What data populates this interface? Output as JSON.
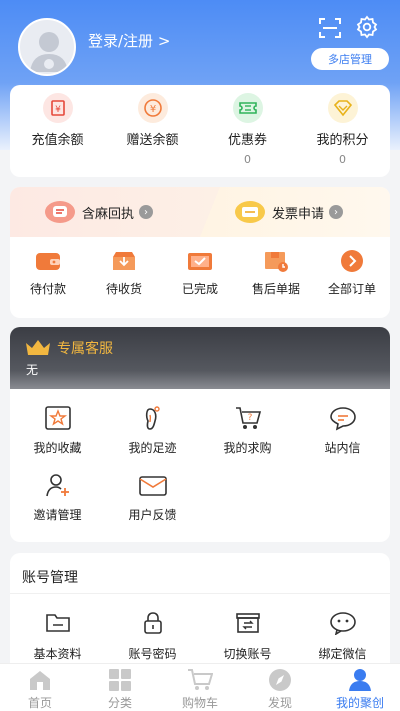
{
  "header": {
    "login_text": "登录/注册 >",
    "store_button": "多店管理"
  },
  "balance": [
    {
      "icon": "recharge-icon",
      "label": "充值余额",
      "value": ""
    },
    {
      "icon": "gift-balance-icon",
      "label": "赠送余额",
      "value": ""
    },
    {
      "icon": "coupon-icon",
      "label": "优惠券",
      "value": "0"
    },
    {
      "icon": "points-icon",
      "label": "我的积分",
      "value": "0"
    }
  ],
  "orders": {
    "receipt_label": "含麻回执",
    "invoice_label": "发票申请",
    "items": [
      {
        "icon": "wallet-icon",
        "label": "待付款"
      },
      {
        "icon": "package-icon",
        "label": "待收货"
      },
      {
        "icon": "completed-icon",
        "label": "已完成"
      },
      {
        "icon": "after-sale-icon",
        "label": "售后单据"
      },
      {
        "icon": "all-orders-icon",
        "label": "全部订单"
      }
    ]
  },
  "service": {
    "title": "专属客服",
    "subtitle": "无",
    "items": [
      {
        "icon": "favorites-icon",
        "label": "我的收藏"
      },
      {
        "icon": "footprint-icon",
        "label": "我的足迹"
      },
      {
        "icon": "wanted-cart-icon",
        "label": "我的求购"
      },
      {
        "icon": "message-icon",
        "label": "站内信"
      },
      {
        "icon": "invite-icon",
        "label": "邀请管理"
      },
      {
        "icon": "feedback-icon",
        "label": "用户反馈"
      }
    ]
  },
  "account": {
    "title": "账号管理",
    "items": [
      {
        "icon": "folder-icon",
        "label": "基本资料"
      },
      {
        "icon": "lock-icon",
        "label": "账号密码"
      },
      {
        "icon": "switch-account-icon",
        "label": "切换账号"
      },
      {
        "icon": "wechat-icon",
        "label": "绑定微信"
      }
    ]
  },
  "tabs": [
    {
      "icon": "home-icon",
      "label": "首页"
    },
    {
      "icon": "category-icon",
      "label": "分类"
    },
    {
      "icon": "cart-icon",
      "label": "购物车"
    },
    {
      "icon": "discover-icon",
      "label": "发现"
    },
    {
      "icon": "profile-icon",
      "label": "我的聚创"
    }
  ],
  "colors": {
    "primary": "#3a7cf0",
    "service_gold": "#f2b740",
    "order_orange": "#f07a3a"
  }
}
